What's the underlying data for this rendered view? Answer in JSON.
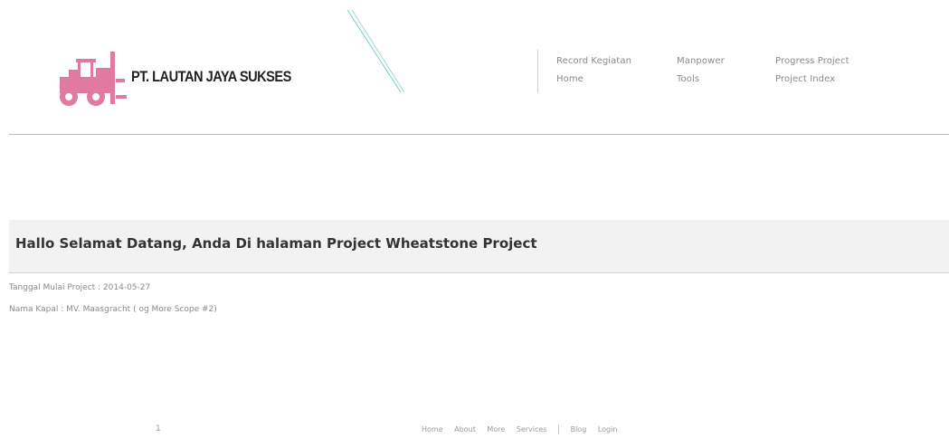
{
  "brand": {
    "name": "PT. LAUTAN JAYA SUKSES",
    "logo_icon": "forklift-icon",
    "logo_color": "#e07aa0"
  },
  "nav": {
    "items": [
      {
        "label": "Record Kegiatan"
      },
      {
        "label": "Manpower"
      },
      {
        "label": "Progress Project"
      },
      {
        "label": "Home"
      },
      {
        "label": "Tools"
      },
      {
        "label": "Project Index"
      }
    ]
  },
  "welcome": {
    "title": "Hallo Selamat Datang, Anda Di halaman Project Wheatstone Project"
  },
  "project_info": {
    "start_date_line": "Tanggal Mulai Project : 2014-05-27",
    "vessel_line": "Nama Kapal : MV. Maasgracht ( og More Scope #2)"
  },
  "pagination": {
    "page": "1"
  },
  "footer": {
    "links": [
      {
        "label": "Home"
      },
      {
        "label": "About"
      },
      {
        "label": "More"
      },
      {
        "label": "Services"
      },
      {
        "label": "Blog"
      },
      {
        "label": "Login"
      }
    ]
  },
  "colors": {
    "accent": "#e07aa0",
    "deco_line": "#6fd0c6",
    "welcome_bg": "#f2f2f2"
  }
}
